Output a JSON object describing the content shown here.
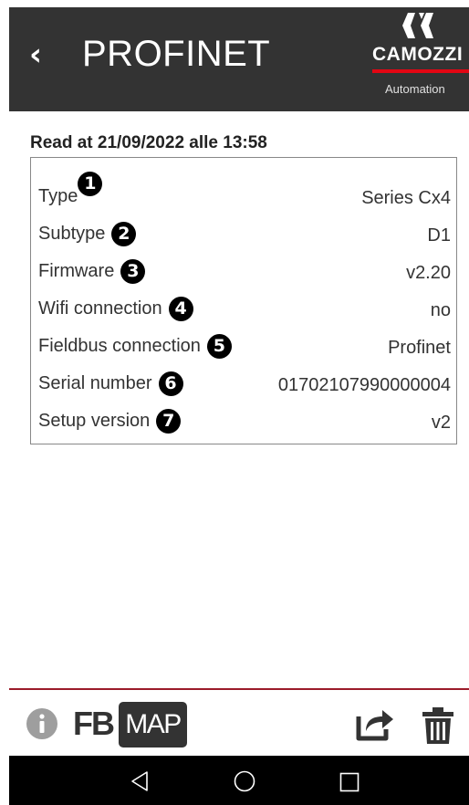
{
  "header": {
    "back_glyph": "‹",
    "title": "PROFINET",
    "logo_text": "CAMOZZI",
    "logo_subtext": "Automation",
    "brand_color": "#e30613",
    "bar_color": "#333333"
  },
  "read_at": "Read at 21/09/2022 alle 13:58",
  "rows": [
    {
      "label": "Type",
      "badge": "1",
      "value": "Series Cx4"
    },
    {
      "label": "Subtype",
      "badge": "2",
      "value": "D1"
    },
    {
      "label": "Firmware",
      "badge": "3",
      "value": "v2.20"
    },
    {
      "label": "Wifi connection",
      "badge": "4",
      "value": "no"
    },
    {
      "label": "Fieldbus connection",
      "badge": "5",
      "value": "Profinet"
    },
    {
      "label": "Serial number",
      "badge": "6",
      "value": "01702107990000004"
    },
    {
      "label": "Setup version",
      "badge": "7",
      "value": "v2"
    }
  ],
  "toolbar": {
    "info_icon": "info-circle-icon",
    "fb_label": "FB",
    "map_label": "MAP",
    "share_icon": "share-icon",
    "trash_icon": "trash-icon",
    "divider_color": "#9b1b2a"
  },
  "navbar": {
    "back_icon": "nav-back-icon",
    "home_icon": "nav-home-icon",
    "recent_icon": "nav-recents-icon"
  }
}
